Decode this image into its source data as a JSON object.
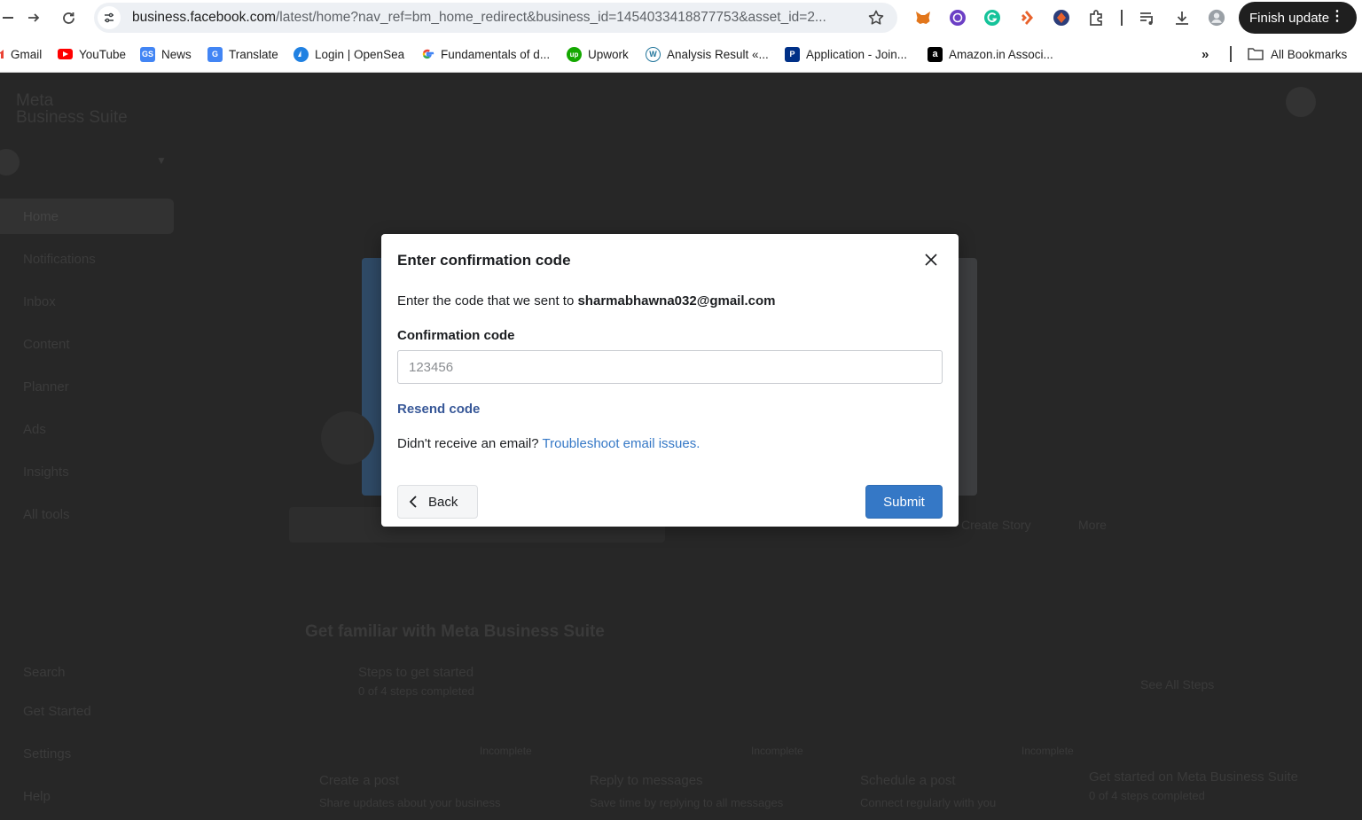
{
  "browser": {
    "url_host": "business.facebook.com",
    "url_path": "/latest/home?nav_ref=bm_home_redirect&business_id=1454033418877753&asset_id=2...",
    "finish_update": "Finish update",
    "bookmarks": [
      {
        "label": "Gmail",
        "icon": "gmail-icon",
        "color": "#ea4335"
      },
      {
        "label": "YouTube",
        "icon": "youtube-icon",
        "color": "#ff0000"
      },
      {
        "label": "News",
        "icon": "news-icon",
        "color": "#4285f4"
      },
      {
        "label": "Translate",
        "icon": "translate-icon",
        "color": "#4285f4"
      },
      {
        "label": "Login | OpenSea",
        "icon": "opensea-icon",
        "color": "#2081e2"
      },
      {
        "label": "Fundamentals of d...",
        "icon": "google-icon",
        "color": "#ffffff"
      },
      {
        "label": "Upwork",
        "icon": "upwork-icon",
        "color": "#14a800"
      },
      {
        "label": "Analysis Result «...",
        "icon": "wordpress-icon",
        "color": "#21759b"
      },
      {
        "label": "Application - Join...",
        "icon": "paypal-icon",
        "color": "#003087"
      },
      {
        "label": "Amazon.in Associ...",
        "icon": "amazon-icon",
        "color": "#000000"
      }
    ],
    "all_bookmarks": "All Bookmarks"
  },
  "background": {
    "brand_line1": "Meta",
    "brand_line2": "Business Suite",
    "sidebar_items": [
      "Home",
      "Notifications",
      "Inbox",
      "Content",
      "Planner",
      "Ads",
      "Insights",
      "All tools"
    ],
    "sidebar_bottom": [
      "Search",
      "Get Started",
      "Settings",
      "Help"
    ],
    "section_title": "Get familiar with Meta Business Suite",
    "steps_title": "Steps to get started",
    "steps_sub": "0 of 4 steps completed",
    "see_all": "See All Steps",
    "tiles": [
      {
        "title": "Create a post",
        "desc": "Share updates about your business",
        "status": "Incomplete"
      },
      {
        "title": "Reply to messages",
        "desc": "Save time by replying to all messages",
        "status": "Incomplete"
      },
      {
        "title": "Schedule a post",
        "desc": "Connect regularly with you",
        "status": "Incomplete"
      }
    ],
    "side_card_title": "Get started on Meta Business Suite",
    "side_card_sub": "0 of 4 steps completed",
    "create_story": "Create Story",
    "more": "More"
  },
  "modal": {
    "title": "Enter confirmation code",
    "instruction": "Enter the code that we sent to",
    "email": "sharmabhawna032@gmail.com",
    "field_label": "Confirmation code",
    "placeholder": "123456",
    "value": "",
    "resend": "Resend code",
    "help_text": "Didn't receive an email?",
    "help_link": "Troubleshoot email issues.",
    "back": "Back",
    "submit": "Submit",
    "accent_color": "#3578c6"
  }
}
